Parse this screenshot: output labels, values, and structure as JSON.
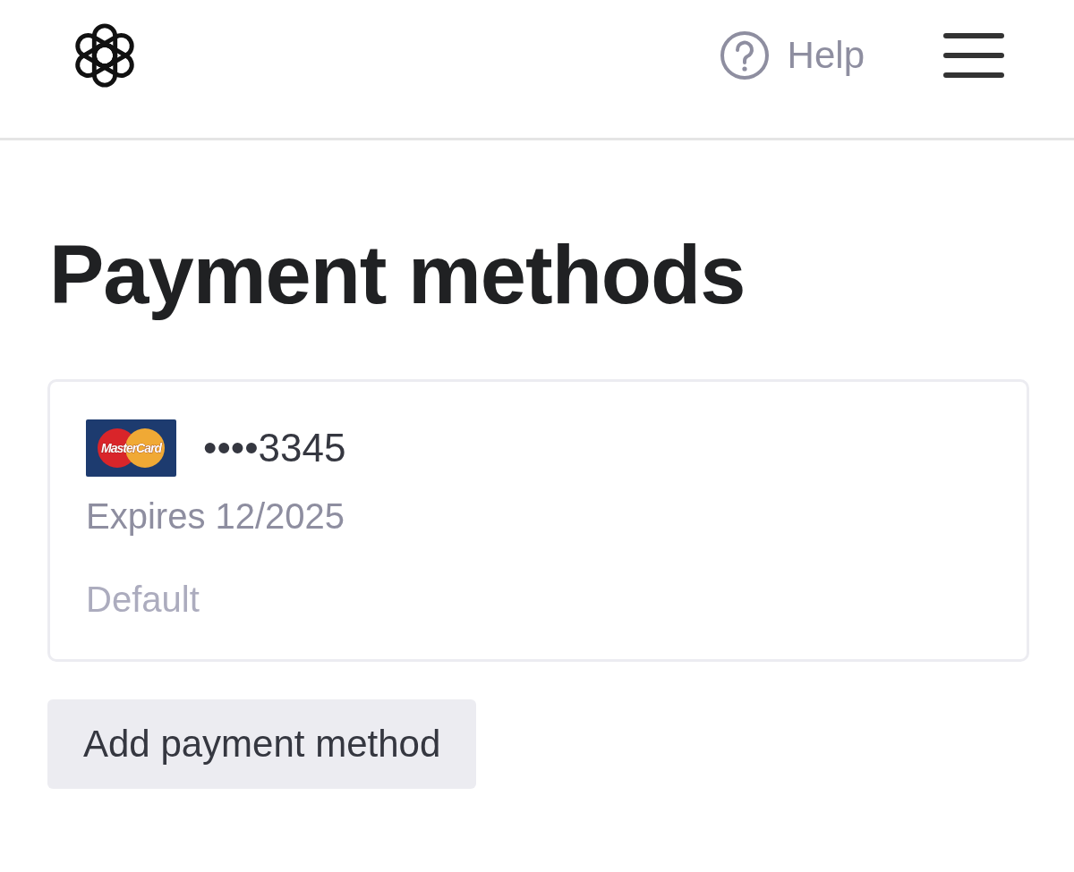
{
  "header": {
    "help_label": "Help"
  },
  "title": "Payment methods",
  "cards": [
    {
      "brand_text": "MasterCard",
      "number": "••••3345",
      "expiry": "Expires 12/2025",
      "status": "Default"
    }
  ],
  "add_button": "Add payment method"
}
